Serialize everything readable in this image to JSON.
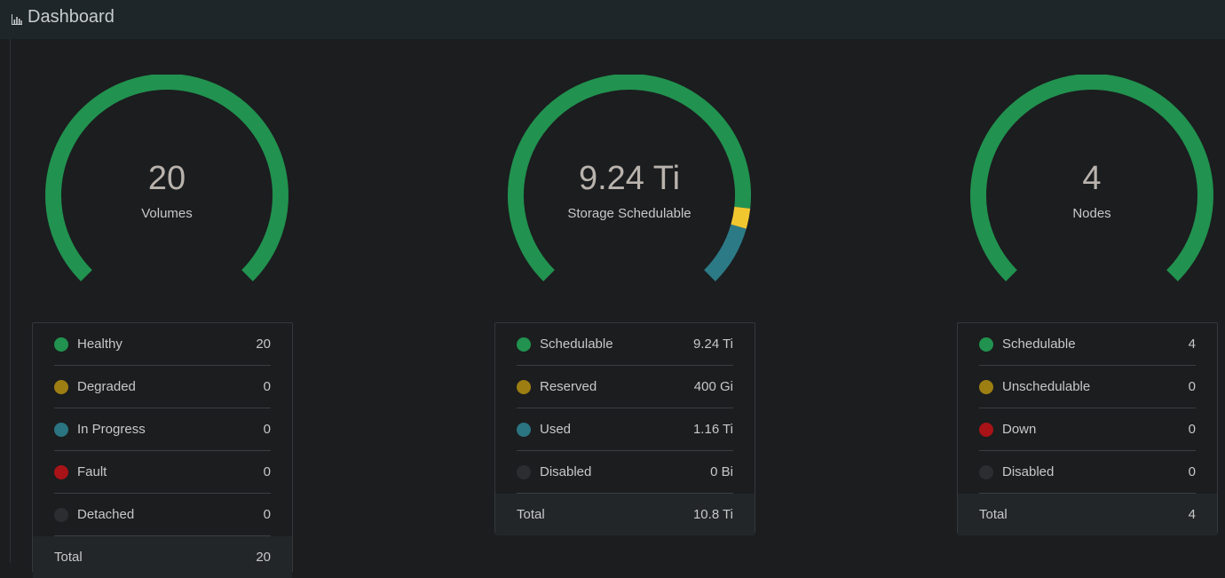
{
  "header": {
    "title": "Dashboard",
    "icon": "bar-chart-icon"
  },
  "colors": {
    "green": "#21924f",
    "yellow": "#f1c730",
    "teal": "#2c7a86",
    "dot_healthy": "#21924f",
    "dot_degraded": "#9d7e12",
    "dot_progress": "#2b7481",
    "dot_fault": "#a81318",
    "dot_disabled": "#2b2d30"
  },
  "volumes": {
    "value": "20",
    "label": "Volumes",
    "segments": [
      {
        "name": "Healthy",
        "value": 20,
        "color": "#21924f"
      }
    ],
    "rows": [
      {
        "label": "Healthy",
        "value": "20",
        "color": "#21924f"
      },
      {
        "label": "Degraded",
        "value": "0",
        "color": "#9d7e12"
      },
      {
        "label": "In Progress",
        "value": "0",
        "color": "#2b7481"
      },
      {
        "label": "Fault",
        "value": "0",
        "color": "#a81318"
      },
      {
        "label": "Detached",
        "value": "0",
        "color": "#2b2d30"
      }
    ],
    "total_label": "Total",
    "total_value": "20"
  },
  "storage": {
    "value": "9.24 Ti",
    "label": "Storage Schedulable",
    "segments": [
      {
        "name": "Schedulable",
        "value": 9.24,
        "color": "#21924f"
      },
      {
        "name": "Reserved",
        "value": 0.39,
        "color": "#f1c730"
      },
      {
        "name": "Used",
        "value": 1.16,
        "color": "#2c7a86"
      }
    ],
    "rows": [
      {
        "label": "Schedulable",
        "value": "9.24 Ti",
        "color": "#21924f"
      },
      {
        "label": "Reserved",
        "value": "400 Gi",
        "color": "#9d7e12"
      },
      {
        "label": "Used",
        "value": "1.16 Ti",
        "color": "#2b7481"
      },
      {
        "label": "Disabled",
        "value": "0 Bi",
        "color": "#2b2d30"
      }
    ],
    "total_label": "Total",
    "total_value": "10.8 Ti"
  },
  "nodes": {
    "value": "4",
    "label": "Nodes",
    "segments": [
      {
        "name": "Schedulable",
        "value": 4,
        "color": "#21924f"
      }
    ],
    "rows": [
      {
        "label": "Schedulable",
        "value": "4",
        "color": "#21924f"
      },
      {
        "label": "Unschedulable",
        "value": "0",
        "color": "#9d7e12"
      },
      {
        "label": "Down",
        "value": "0",
        "color": "#a81318"
      },
      {
        "label": "Disabled",
        "value": "0",
        "color": "#2b2d30"
      }
    ],
    "total_label": "Total",
    "total_value": "4"
  }
}
